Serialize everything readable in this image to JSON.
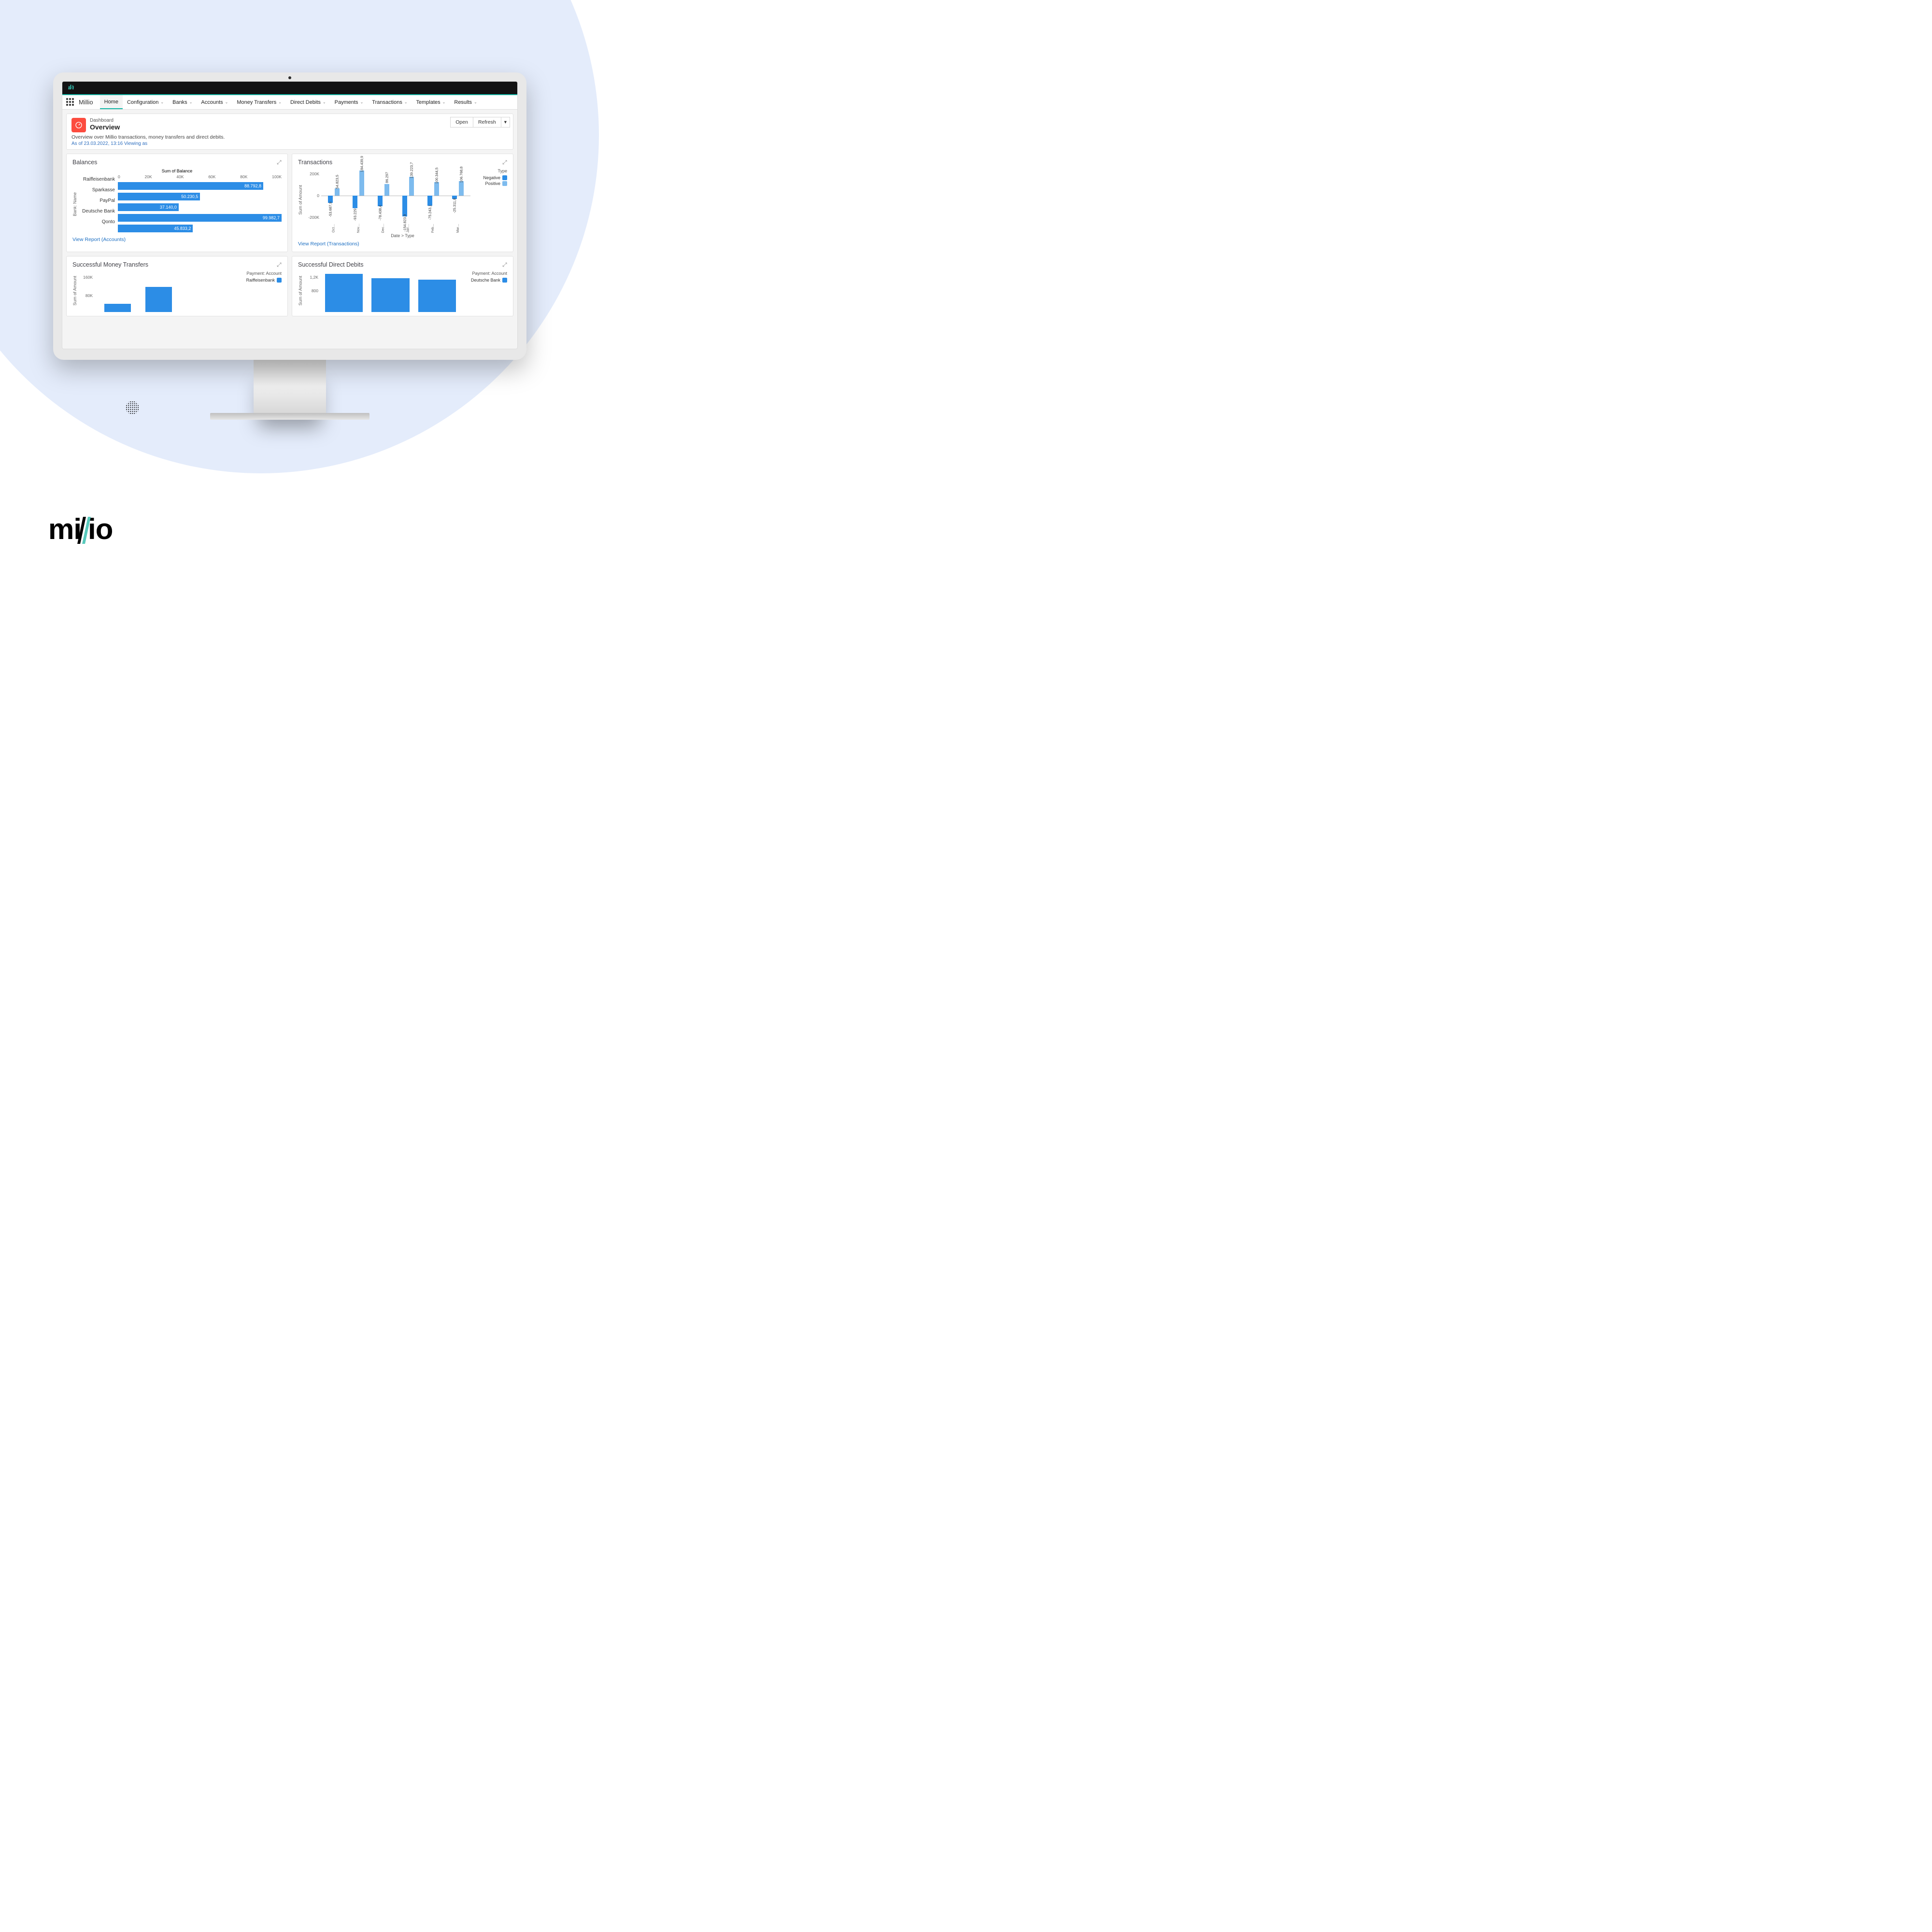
{
  "brand": {
    "name": "millio"
  },
  "topbar": {
    "logo_text": "ıl/ı"
  },
  "nav": {
    "app_name": "Millio",
    "items": [
      {
        "label": "Home",
        "active": true,
        "dropdown": false
      },
      {
        "label": "Configuration",
        "dropdown": true
      },
      {
        "label": "Banks",
        "dropdown": true
      },
      {
        "label": "Accounts",
        "dropdown": true
      },
      {
        "label": "Money Transfers",
        "dropdown": true
      },
      {
        "label": "Direct Debits",
        "dropdown": true
      },
      {
        "label": "Payments",
        "dropdown": true
      },
      {
        "label": "Transactions",
        "dropdown": true
      },
      {
        "label": "Templates",
        "dropdown": true
      },
      {
        "label": "Results",
        "dropdown": true
      }
    ]
  },
  "header": {
    "breadcrumb": "Dashboard",
    "title": "Overview",
    "description": "Overview over Millio transactions, money transfers and direct debits.",
    "as_of": "As of 23.03.2022, 13:16 Viewing as",
    "open": "Open",
    "refresh": "Refresh"
  },
  "balances": {
    "card_title": "Balances",
    "x_title": "Sum of Balance",
    "y_title": "Bank: Name",
    "link": "View Report (Accounts)",
    "ticks": [
      "0",
      "20K",
      "40K",
      "60K",
      "80K",
      "100K"
    ]
  },
  "transactions": {
    "card_title": "Transactions",
    "y_title": "Sum of Amount",
    "x_title": "Date > Type",
    "legend_title": "Type",
    "legend_neg": "Negative",
    "legend_pos": "Positive",
    "link": "View Report (Transactions)",
    "y_ticks": {
      "top": "200K",
      "mid": "0",
      "bot": "-200K"
    }
  },
  "smt": {
    "card_title": "Successful Money Transfers",
    "y_title": "Sum of Amount",
    "legend_title": "Payment: Account",
    "legend_item": "Raiffeisenbank",
    "y_ticks": {
      "a": "160K",
      "b": "80K"
    }
  },
  "sdd": {
    "card_title": "Successful Direct Debits",
    "y_title": "Sum of Amount",
    "legend_title": "Payment: Account",
    "legend_item": "Deutsche Bank",
    "y_ticks": {
      "a": "1,2K",
      "b": "800"
    }
  },
  "chart_data": [
    {
      "id": "balances",
      "type": "bar",
      "orientation": "horizontal",
      "title": "Balances",
      "xlabel": "Sum of Balance",
      "ylabel": "Bank: Name",
      "x_ticks": [
        0,
        20000,
        40000,
        60000,
        80000,
        100000
      ],
      "categories": [
        "Raiffeisenbank",
        "Sparkasse",
        "PayPal",
        "Deutsche Bank",
        "Qonto"
      ],
      "values": [
        88792.8,
        50230.5,
        37140.0,
        99982.7,
        45833.2
      ],
      "value_labels": [
        "88.792,8",
        "50.230,5",
        "37.140,0",
        "99.982,7",
        "45.833,2"
      ],
      "xlim": [
        0,
        100000
      ]
    },
    {
      "id": "transactions",
      "type": "bar",
      "title": "Transactions",
      "xlabel": "Date > Type",
      "ylabel": "Sum of Amount",
      "ylim": [
        -200000,
        200000
      ],
      "y_ticks": [
        -200000,
        0,
        200000
      ],
      "categories": [
        "Oct",
        "Nov",
        "Dec",
        "Jan",
        "Feb",
        "Mar"
      ],
      "legend_title": "Type",
      "series": [
        {
          "name": "Negative",
          "color": "#2c8de6",
          "values": [
            -53687.9,
            -93229,
            -78438.4,
            -154823.9,
            -75243.1,
            -25311.8
          ],
          "value_labels": [
            "-53.687,9",
            "-93.229",
            "-78.438,4",
            "-154.823,9",
            "-75.243,1",
            "-25.311,8"
          ]
        },
        {
          "name": "Positive",
          "color": "#7dbbee",
          "values": [
            54823.5,
            184439.9,
            86297,
            139223.7,
            100344.5,
            106768.8
          ],
          "value_labels": [
            "54.823,5",
            "184.439,9",
            "86.297",
            "139.223,7",
            "100.344,5",
            "106.768,8"
          ]
        }
      ],
      "x_subticks": [
        "No…",
        "Po…",
        "No…",
        "Po…",
        "No…",
        "Po…",
        "No…",
        "Po…",
        "No…",
        "Po…",
        "No…",
        "Po…"
      ]
    },
    {
      "id": "successful_money_transfers",
      "type": "bar",
      "title": "Successful Money Transfers",
      "ylabel": "Sum of Amount",
      "legend_title": "Payment: Account",
      "y_ticks": [
        80000,
        160000
      ],
      "ylim": [
        0,
        180000
      ],
      "series": [
        {
          "name": "Raiffeisenbank",
          "color": "#2c8de6",
          "values": [
            35000,
            110000
          ]
        }
      ]
    },
    {
      "id": "successful_direct_debits",
      "type": "bar",
      "title": "Successful Direct Debits",
      "ylabel": "Sum of Amount",
      "legend_title": "Payment: Account",
      "y_ticks": [
        800,
        1200
      ],
      "ylim": [
        0,
        1400
      ],
      "series": [
        {
          "name": "Deutsche Bank",
          "color": "#2c8de6",
          "values": [
            1300,
            1150,
            1100
          ]
        }
      ]
    }
  ]
}
